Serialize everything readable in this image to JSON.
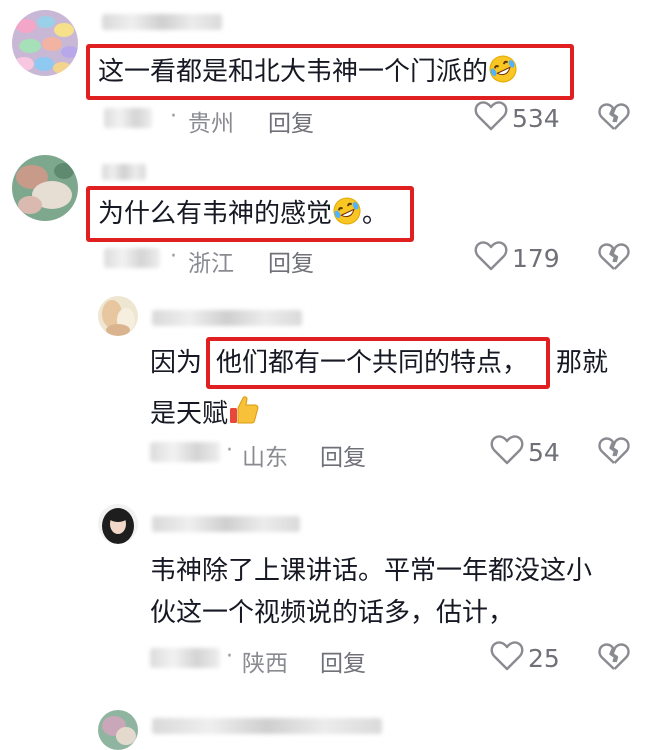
{
  "comments": [
    {
      "text_lines": [
        "这一看都是和北大韦神一个门派的"
      ],
      "emoji": "rofl",
      "location": "贵州",
      "reply_label": "回复",
      "likes": "534"
    },
    {
      "text_lines": [
        "为什么有韦神的感觉"
      ],
      "emoji": "rofl",
      "text_suffix": "。",
      "location": "浙江",
      "reply_label": "回复",
      "likes": "179"
    },
    {
      "text_lines": [
        "因为",
        "他们都有一个共同的特点，",
        "那就",
        "是天赋"
      ],
      "emoji": "thumbs-up",
      "location": "山东",
      "reply_label": "回复",
      "likes": "54"
    },
    {
      "text_lines": [
        "韦神除了上课讲话。平常一年都没这小",
        "伙这一个视频说的话多，估计，"
      ],
      "location": "陕西",
      "reply_label": "回复",
      "likes": "25"
    }
  ],
  "icons": {
    "like": "heart-outline-icon",
    "dislike": "broken-heart-icon"
  },
  "colors": {
    "highlight_border": "#e02020",
    "text": "#161823",
    "meta": "#8a8b91"
  }
}
